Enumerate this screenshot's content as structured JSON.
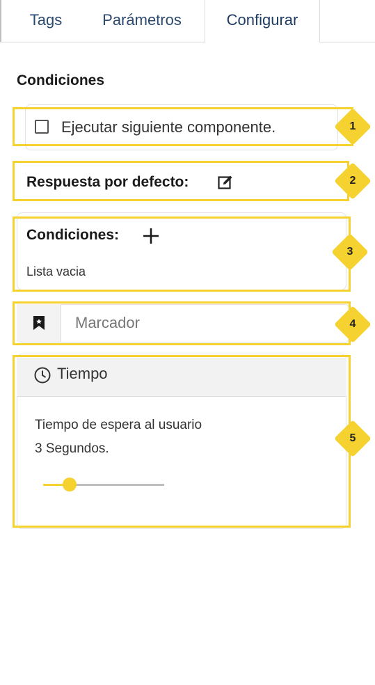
{
  "tabs": [
    {
      "label": "Tags",
      "active": false
    },
    {
      "label": "Parámetros",
      "active": false
    },
    {
      "label": "Configurar",
      "active": true
    }
  ],
  "section_title": "Condiciones",
  "execute_next": {
    "label": "Ejecutar siguiente componente.",
    "checked": false
  },
  "default_response": {
    "label": "Respuesta por defecto:",
    "icon": "edit-icon"
  },
  "conditions": {
    "label": "Condiciones:",
    "add_icon": "plus-icon",
    "empty_text": "Lista vacia"
  },
  "bookmark": {
    "icon": "bookmark-icon",
    "placeholder": "Marcador",
    "value": ""
  },
  "time_panel": {
    "icon": "clock-icon",
    "title": "Tiempo",
    "description": "Tiempo de espera al usuario",
    "value_text": "3 Segundos.",
    "slider_fraction": 0.22
  },
  "badges": [
    "1",
    "2",
    "3",
    "4",
    "5"
  ],
  "colors": {
    "highlight": "#f5d230",
    "tab_text": "#2b4a70"
  }
}
